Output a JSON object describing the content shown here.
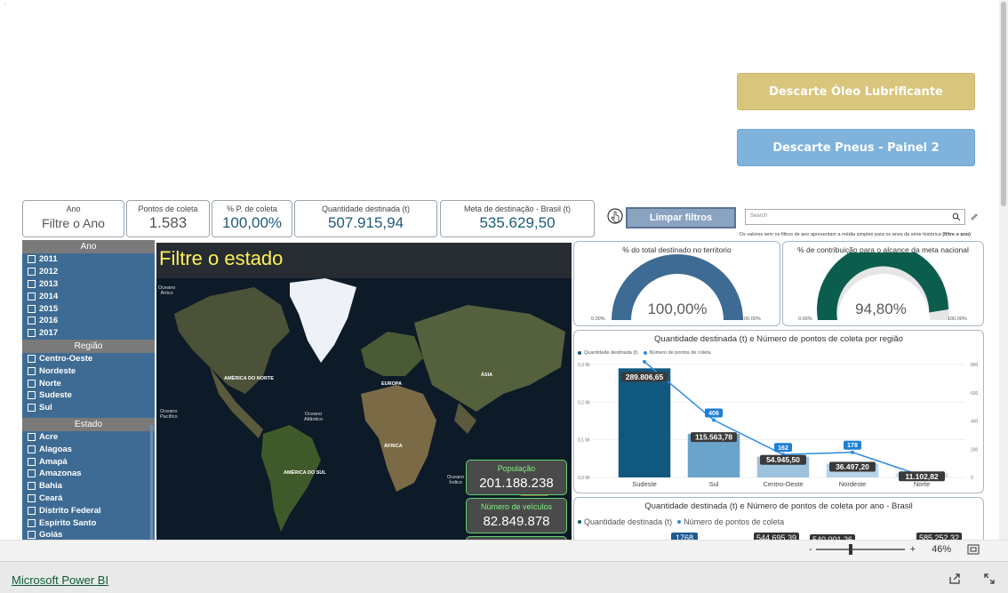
{
  "nav": {
    "btn_oleo": "Descarte Óleo Lubrificante",
    "btn_pneus": "Descarte Pneus - Painel 2",
    "colors": {
      "oleo": "#d9c57c",
      "pneus": "#7fb3dc"
    }
  },
  "kpis": {
    "ano": {
      "label": "Ano",
      "value": "Filtre o Ano"
    },
    "pontos": {
      "label": "Pontos de coleta",
      "value": "1.583"
    },
    "pcoleta": {
      "label": "% P. de coleta",
      "value": "100,00%"
    },
    "quantidade": {
      "label": "Quantidade destinada (t)",
      "value": "507.915,94"
    },
    "meta": {
      "label": "Meta de destinação - Brasil (t)",
      "value": "535.629,50"
    }
  },
  "toolbar": {
    "clear_label": "Limpar filtros",
    "search_placeholder": "Search",
    "note_prefix": "Os valores sem os filtros de ano apresentam a média simples para os anos da série histórica ",
    "note_bold": "(filtre o ano)"
  },
  "slicers": {
    "ano_header": "Ano",
    "anos": [
      "2011",
      "2012",
      "2013",
      "2014",
      "2015",
      "2016",
      "2017"
    ],
    "regiao_header": "Região",
    "regioes": [
      "Centro-Oeste",
      "Nordeste",
      "Norte",
      "Sudeste",
      "Sul"
    ],
    "estado_header": "Estado",
    "estados": [
      "Acre",
      "Alagoas",
      "Amapá",
      "Amazonas",
      "Bahia",
      "Ceará",
      "Distrito Federal",
      "Espírito Santo",
      "Goiás"
    ]
  },
  "map": {
    "title": "Filtre o estado",
    "labels": {
      "america_norte": "AMÉRICA DO NORTE",
      "europa": "EUROPA",
      "asia": "ÁSIA",
      "africa": "ÁFRICA",
      "america_sul": "AMÉRICA DO SUL",
      "oceano_artico": "Oceano\nÁrtico",
      "oceano_pacifico": "Oceano\nPacífico",
      "oceano_atlantico": "Oceano\nAtlântico",
      "oceano_indico": "Oceano\nÍndico"
    },
    "populacao_label": "População",
    "populacao_value": "201.188.238",
    "veiculos_label": "Número de veículos",
    "veiculos_value": "82.849.878"
  },
  "gauges": {
    "territorio": {
      "title": "% do total destinado no territorio",
      "value_text": "100,00%",
      "fraction": 1.0,
      "min": "0.00%",
      "max": "100.00%",
      "color": "#3e6b93"
    },
    "meta": {
      "title": "% de contribuição para o alcance da meta nacional",
      "value_text": "94,80%",
      "fraction": 0.948,
      "min": "0.00%",
      "max": "100.00%",
      "color": "#0b5e4d"
    }
  },
  "chart_data": [
    {
      "type": "bar",
      "title": "Quantidade destinada (t) e Número de pontos de coleta por região",
      "categories": [
        "Sudeste",
        "Sul",
        "Centro-Oeste",
        "Nordeste",
        "Norte"
      ],
      "series": [
        {
          "name": "Quantidade destinada (t)",
          "values": [
            289806.65,
            115563.78,
            54945.5,
            36497.2,
            11102.82
          ],
          "labels": [
            "289.806,65",
            "115.563,78",
            "54.945,50",
            "36.497,20",
            "11.102,82"
          ],
          "colors": [
            "#11587f",
            "#6ba4cb",
            "#9cc2de",
            "#b6d2e8",
            "#cfe1ef"
          ]
        },
        {
          "name": "Número de pontos de coleta",
          "type": "line",
          "values": [
            820,
            406,
            162,
            178,
            12
          ],
          "labels": [
            "",
            "406",
            "162",
            "178",
            ""
          ],
          "color": "#2e8be0"
        }
      ],
      "y_ticks": [
        "0,0 Mi",
        "0,1 Mi",
        "0,2 Mi",
        "0,3 Mi"
      ],
      "y2_ticks": [
        "0",
        "200",
        "400",
        "600",
        "800"
      ],
      "ylim": [
        0,
        300000
      ],
      "y2lim": [
        0,
        800
      ]
    },
    {
      "type": "bar",
      "title": "Quantidade destinada (t) e Número de pontos de coleta por ano - Brasil",
      "series": [
        {
          "name": "Quantidade destinada (t)",
          "visible_labels": [
            "544.695,39",
            "540.001,26",
            "585.252,32"
          ]
        },
        {
          "name": "Número de pontos de coleta",
          "visible_labels": [
            "1768"
          ]
        }
      ]
    }
  ],
  "bottom": {
    "zoom_minus": "-",
    "zoom_plus": "+",
    "zoom_value": "46%",
    "zoom_fraction": 0.37,
    "brand": "Microsoft Power BI"
  }
}
